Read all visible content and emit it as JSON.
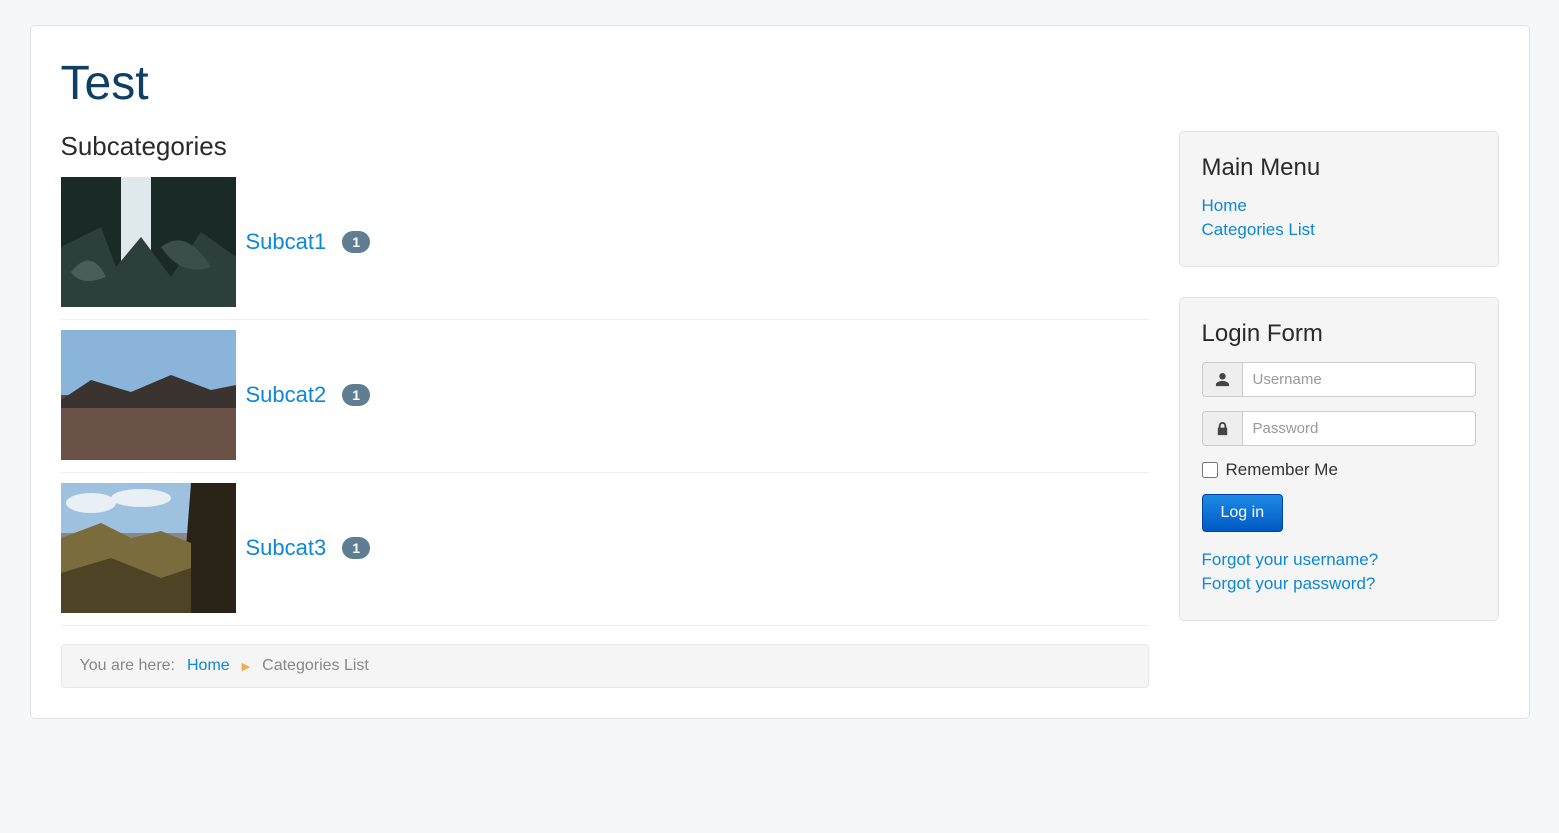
{
  "page_title": "Test",
  "subcategories_heading": "Subcategories",
  "subcategories": [
    {
      "label": "Subcat1",
      "count": "1"
    },
    {
      "label": "Subcat2",
      "count": "1"
    },
    {
      "label": "Subcat3",
      "count": "1"
    }
  ],
  "breadcrumb": {
    "prefix": "You are here:",
    "home": "Home",
    "current": "Categories List"
  },
  "main_menu": {
    "heading": "Main Menu",
    "items": [
      {
        "label": "Home"
      },
      {
        "label": "Categories List"
      }
    ]
  },
  "login_form": {
    "heading": "Login Form",
    "username_placeholder": "Username",
    "password_placeholder": "Password",
    "remember_label": "Remember Me",
    "submit_label": "Log in",
    "forgot_username": "Forgot your username?",
    "forgot_password": "Forgot your password?"
  }
}
